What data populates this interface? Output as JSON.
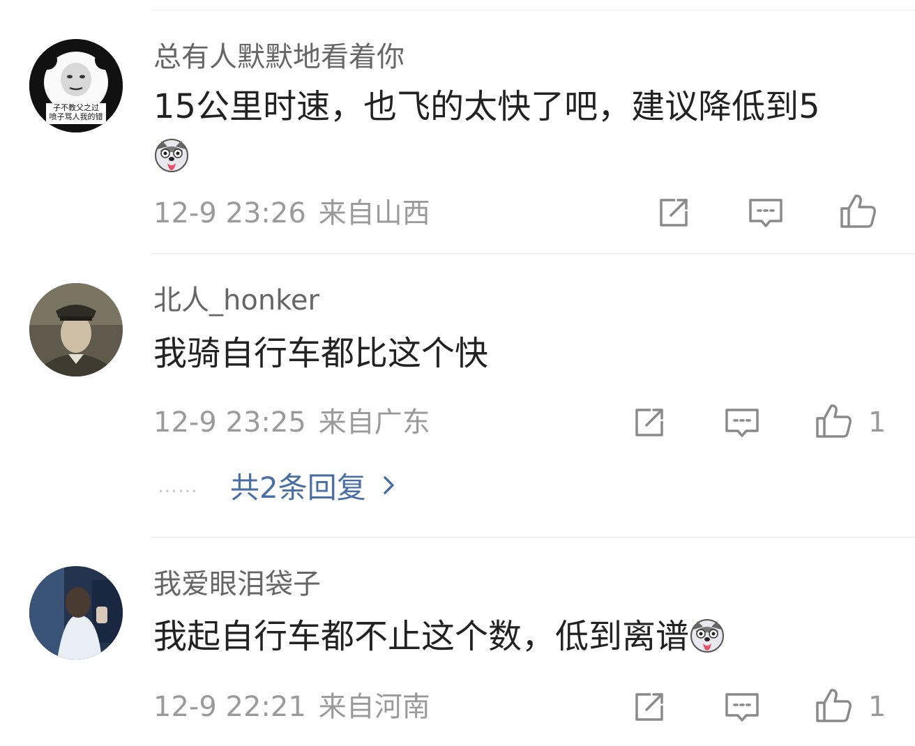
{
  "comments": [
    {
      "username": "总有人默默地看着你",
      "text": "15公里时速，也飞的太快了吧，建议降低到5",
      "avatar_caption_1": "子不教父之过",
      "avatar_caption_2": "喷子骂人我的错",
      "timestamp": "12-9 23:26",
      "location": "来自山西",
      "likes": ""
    },
    {
      "username": "北人_honker",
      "text": "我骑自行车都比这个快",
      "timestamp": "12-9 23:25",
      "location": "来自广东",
      "likes": "1",
      "replies": {
        "dots": "……",
        "label": "共2条回复"
      }
    },
    {
      "username": "我爱眼泪袋子",
      "text": "我起自行车都不止这个数，低到离谱",
      "timestamp": "12-9 22:21",
      "location": "来自河南",
      "likes": "1"
    }
  ],
  "icons": {
    "share": "share-icon",
    "comment": "comment-icon",
    "like": "thumbs-up-icon",
    "emoji": "husky-face-emoji",
    "chevron": "chevron-right-icon"
  },
  "colors": {
    "username": "#666666",
    "content": "#222222",
    "meta": "#9a9a9a",
    "reply_link": "#4a6fa5",
    "icon": "#8a8a8a"
  }
}
